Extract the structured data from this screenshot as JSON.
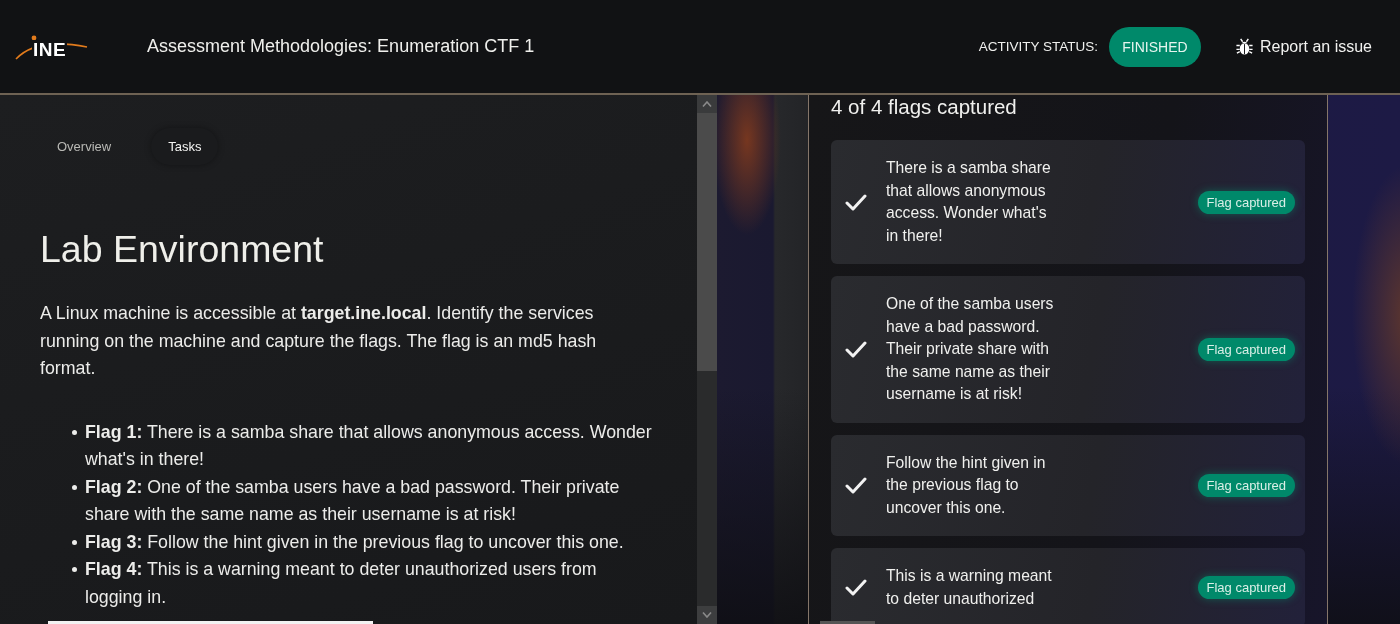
{
  "header": {
    "logo": "INE",
    "title": "Assessment Methodologies: Enumeration CTF 1",
    "status_label": "ACTIVITY STATUS:",
    "status": "FINISHED",
    "report_link": "Report an issue"
  },
  "tabs": [
    {
      "label": "Overview",
      "selected": false
    },
    {
      "label": "Tasks",
      "selected": true
    }
  ],
  "content": {
    "heading": "Lab Environment",
    "intro": "A Linux machine is accessible at **target.ine.local**. Identify the services running on the machine and capture the flags. The flag is an md5 hash format.",
    "flags": [
      "**Flag 1:** There is a samba share that allows anonymous access. Wonder what's in there!",
      "**Flag 2:** One of the samba users have a bad password. Their private share with the same name as their username is at risk!",
      "**Flag 3:** Follow the hint given in the previous flag to uncover this one.",
      "**Flag 4:** This is a warning meant to deter unauthorized users from logging in."
    ]
  },
  "flags_panel": {
    "summary": "4 of 4 flags captured",
    "flags": [
      {
        "text": "There is a samba share that allows anonymous access. Wonder what's in there!",
        "captured": true,
        "badge": "Flag captured"
      },
      {
        "text": "One of the samba users have a bad password. Their private share with the same name as their username is at risk!",
        "captured": true,
        "badge": "Flag captured"
      },
      {
        "text": "Follow the hint given in the previous flag to uncover this one.",
        "captured": true,
        "badge": "Flag captured"
      },
      {
        "text": "This is a warning meant to deter unauthorized",
        "captured": true,
        "badge": "Flag captured"
      }
    ]
  }
}
